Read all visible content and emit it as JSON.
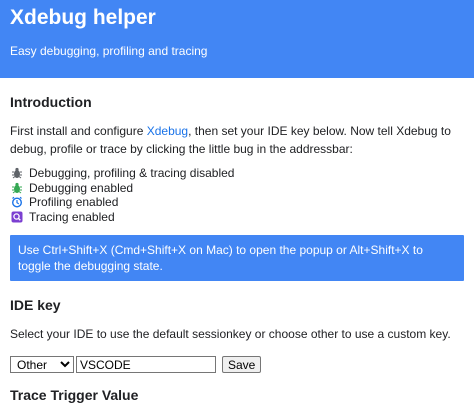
{
  "header": {
    "title": "Xdebug helper",
    "subtitle": "Easy debugging, profiling and tracing"
  },
  "intro": {
    "heading": "Introduction",
    "text_before": "First install and configure ",
    "link": "Xdebug",
    "text_after": ", then set your IDE key below. Now tell Xdebug to debug, profile or trace by clicking the little bug in the addressbar:",
    "statuses": [
      {
        "icon": "bug-disabled-icon",
        "label": "Debugging, profiling & tracing disabled",
        "color": "#5f6368"
      },
      {
        "icon": "bug-enabled-icon",
        "label": "Debugging enabled",
        "color": "#34a853"
      },
      {
        "icon": "clock-icon",
        "label": "Profiling enabled",
        "color": "#1a73e8"
      },
      {
        "icon": "trace-icon",
        "label": "Tracing enabled",
        "color": "#7b3fd1"
      }
    ],
    "hint": "Use Ctrl+Shift+X (Cmd+Shift+X on Mac) to open the popup or Alt+Shift+X to toggle the debugging state."
  },
  "idekey": {
    "heading": "IDE key",
    "description": "Select your IDE to use the default sessionkey or choose other to use a custom key.",
    "select_value": "Other",
    "input_value": "VSCODE",
    "save_label": "Save"
  },
  "next_section": {
    "heading": "Trace Trigger Value"
  },
  "colors": {
    "accent": "#4286f4",
    "link": "#1a73e8"
  }
}
